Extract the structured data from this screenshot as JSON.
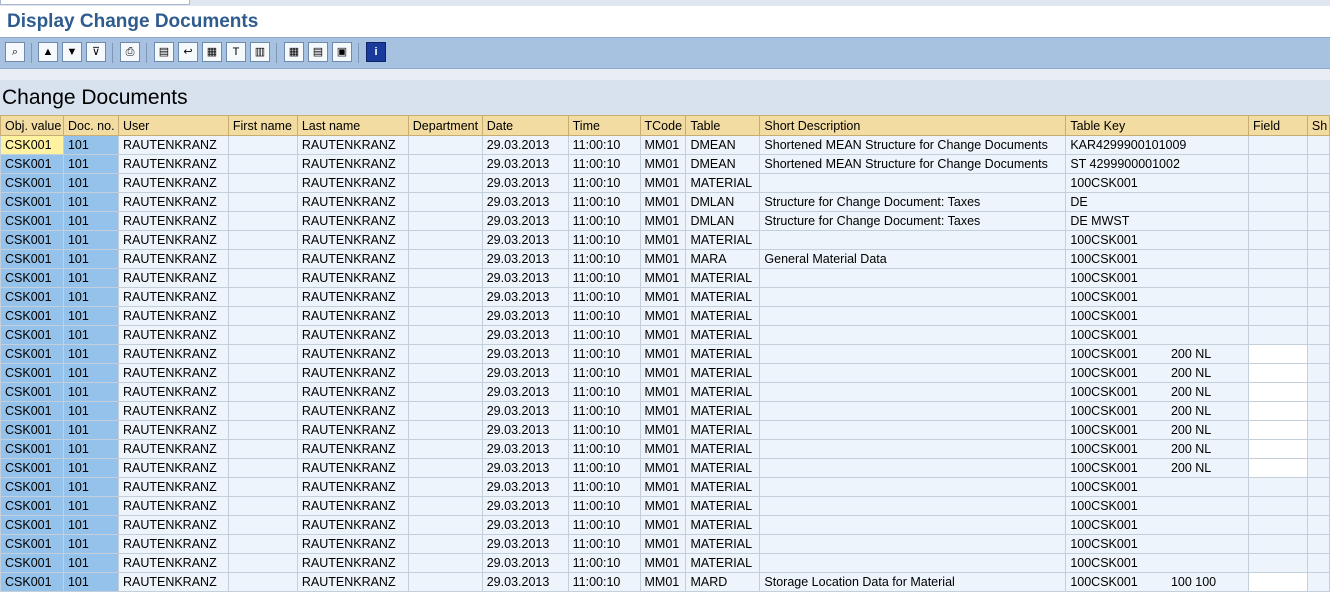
{
  "window": {
    "title": "Display Change Documents"
  },
  "toolbar": {
    "buttons": [
      {
        "icon": "details-icon",
        "glyph": "⌕"
      },
      {
        "icon": "sort-ascending-icon",
        "glyph": "▲"
      },
      {
        "icon": "sort-descending-icon",
        "glyph": "▼"
      },
      {
        "icon": "filter-icon",
        "glyph": "⊽"
      },
      {
        "icon": "print-preview-icon",
        "glyph": "⎙"
      },
      {
        "icon": "export-icon",
        "glyph": "▤"
      },
      {
        "icon": "send-icon",
        "glyph": "↩"
      },
      {
        "icon": "spreadsheet-icon",
        "glyph": "▦"
      },
      {
        "icon": "word-processing-icon",
        "glyph": "T"
      },
      {
        "icon": "graphic-icon",
        "glyph": "▥"
      },
      {
        "icon": "change-layout-icon",
        "glyph": "▦"
      },
      {
        "icon": "select-layout-icon",
        "glyph": "▤"
      },
      {
        "icon": "save-layout-icon",
        "glyph": "▣"
      },
      {
        "icon": "information-icon",
        "glyph": "i"
      }
    ]
  },
  "section": {
    "title": "Change Documents"
  },
  "table": {
    "columns": [
      "Obj. value",
      "Doc. no.",
      "User",
      "First name",
      "Last name",
      "Department",
      "Date",
      "Time",
      "TCode",
      "Table",
      "Short Description",
      "Table Key",
      "Field",
      "Sh"
    ],
    "rows": [
      [
        "CSK001",
        "101",
        "RAUTENKRANZ",
        "",
        "RAUTENKRANZ",
        "",
        "29.03.2013",
        "11:00:10",
        "MM01",
        "DMEAN",
        "Shortened MEAN Structure for Change Documents",
        "KAR4299900101009",
        ""
      ],
      [
        "CSK001",
        "101",
        "RAUTENKRANZ",
        "",
        "RAUTENKRANZ",
        "",
        "29.03.2013",
        "11:00:10",
        "MM01",
        "DMEAN",
        "Shortened MEAN Structure for Change Documents",
        "ST 4299900001002",
        ""
      ],
      [
        "CSK001",
        "101",
        "RAUTENKRANZ",
        "",
        "RAUTENKRANZ",
        "",
        "29.03.2013",
        "11:00:10",
        "MM01",
        "MATERIAL",
        "",
        "100CSK001",
        ""
      ],
      [
        "CSK001",
        "101",
        "RAUTENKRANZ",
        "",
        "RAUTENKRANZ",
        "",
        "29.03.2013",
        "11:00:10",
        "MM01",
        "DMLAN",
        "Structure for Change Document: Taxes",
        "DE",
        ""
      ],
      [
        "CSK001",
        "101",
        "RAUTENKRANZ",
        "",
        "RAUTENKRANZ",
        "",
        "29.03.2013",
        "11:00:10",
        "MM01",
        "DMLAN",
        "Structure for Change Document: Taxes",
        "DE MWST",
        ""
      ],
      [
        "CSK001",
        "101",
        "RAUTENKRANZ",
        "",
        "RAUTENKRANZ",
        "",
        "29.03.2013",
        "11:00:10",
        "MM01",
        "MATERIAL",
        "",
        "100CSK001",
        ""
      ],
      [
        "CSK001",
        "101",
        "RAUTENKRANZ",
        "",
        "RAUTENKRANZ",
        "",
        "29.03.2013",
        "11:00:10",
        "MM01",
        "MARA",
        "General Material Data",
        "100CSK001",
        ""
      ],
      [
        "CSK001",
        "101",
        "RAUTENKRANZ",
        "",
        "RAUTENKRANZ",
        "",
        "29.03.2013",
        "11:00:10",
        "MM01",
        "MATERIAL",
        "",
        "100CSK001",
        ""
      ],
      [
        "CSK001",
        "101",
        "RAUTENKRANZ",
        "",
        "RAUTENKRANZ",
        "",
        "29.03.2013",
        "11:00:10",
        "MM01",
        "MATERIAL",
        "",
        "100CSK001",
        ""
      ],
      [
        "CSK001",
        "101",
        "RAUTENKRANZ",
        "",
        "RAUTENKRANZ",
        "",
        "29.03.2013",
        "11:00:10",
        "MM01",
        "MATERIAL",
        "",
        "100CSK001",
        ""
      ],
      [
        "CSK001",
        "101",
        "RAUTENKRANZ",
        "",
        "RAUTENKRANZ",
        "",
        "29.03.2013",
        "11:00:10",
        "MM01",
        "MATERIAL",
        "",
        "100CSK001",
        ""
      ],
      [
        "CSK001",
        "101",
        "RAUTENKRANZ",
        "",
        "RAUTENKRANZ",
        "",
        "29.03.2013",
        "11:00:10",
        "MM01",
        "MATERIAL",
        "",
        "100CSK001",
        "200 NL"
      ],
      [
        "CSK001",
        "101",
        "RAUTENKRANZ",
        "",
        "RAUTENKRANZ",
        "",
        "29.03.2013",
        "11:00:10",
        "MM01",
        "MATERIAL",
        "",
        "100CSK001",
        "200 NL"
      ],
      [
        "CSK001",
        "101",
        "RAUTENKRANZ",
        "",
        "RAUTENKRANZ",
        "",
        "29.03.2013",
        "11:00:10",
        "MM01",
        "MATERIAL",
        "",
        "100CSK001",
        "200 NL"
      ],
      [
        "CSK001",
        "101",
        "RAUTENKRANZ",
        "",
        "RAUTENKRANZ",
        "",
        "29.03.2013",
        "11:00:10",
        "MM01",
        "MATERIAL",
        "",
        "100CSK001",
        "200 NL"
      ],
      [
        "CSK001",
        "101",
        "RAUTENKRANZ",
        "",
        "RAUTENKRANZ",
        "",
        "29.03.2013",
        "11:00:10",
        "MM01",
        "MATERIAL",
        "",
        "100CSK001",
        "200 NL"
      ],
      [
        "CSK001",
        "101",
        "RAUTENKRANZ",
        "",
        "RAUTENKRANZ",
        "",
        "29.03.2013",
        "11:00:10",
        "MM01",
        "MATERIAL",
        "",
        "100CSK001",
        "200 NL"
      ],
      [
        "CSK001",
        "101",
        "RAUTENKRANZ",
        "",
        "RAUTENKRANZ",
        "",
        "29.03.2013",
        "11:00:10",
        "MM01",
        "MATERIAL",
        "",
        "100CSK001",
        "200 NL"
      ],
      [
        "CSK001",
        "101",
        "RAUTENKRANZ",
        "",
        "RAUTENKRANZ",
        "",
        "29.03.2013",
        "11:00:10",
        "MM01",
        "MATERIAL",
        "",
        "100CSK001",
        ""
      ],
      [
        "CSK001",
        "101",
        "RAUTENKRANZ",
        "",
        "RAUTENKRANZ",
        "",
        "29.03.2013",
        "11:00:10",
        "MM01",
        "MATERIAL",
        "",
        "100CSK001",
        ""
      ],
      [
        "CSK001",
        "101",
        "RAUTENKRANZ",
        "",
        "RAUTENKRANZ",
        "",
        "29.03.2013",
        "11:00:10",
        "MM01",
        "MATERIAL",
        "",
        "100CSK001",
        ""
      ],
      [
        "CSK001",
        "101",
        "RAUTENKRANZ",
        "",
        "RAUTENKRANZ",
        "",
        "29.03.2013",
        "11:00:10",
        "MM01",
        "MATERIAL",
        "",
        "100CSK001",
        ""
      ],
      [
        "CSK001",
        "101",
        "RAUTENKRANZ",
        "",
        "RAUTENKRANZ",
        "",
        "29.03.2013",
        "11:00:10",
        "MM01",
        "MATERIAL",
        "",
        "100CSK001",
        ""
      ],
      [
        "CSK001",
        "101",
        "RAUTENKRANZ",
        "",
        "RAUTENKRANZ",
        "",
        "29.03.2013",
        "11:00:10",
        "MM01",
        "MARD",
        "Storage Location Data for Material",
        "100CSK001",
        "100 100"
      ]
    ]
  },
  "colors": {
    "title": "#2f5c8f",
    "toolbar_bg": "#a7c1e0",
    "header_bg": "#f3dca2",
    "key_cell_bg": "#94c2ea",
    "selected_cell_bg": "#fff2a1",
    "data_cell_bg": "#edf4fb"
  }
}
